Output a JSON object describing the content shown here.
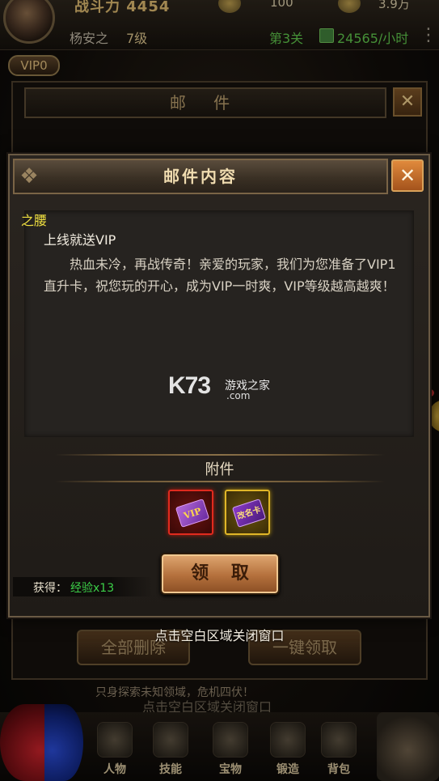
{
  "hud": {
    "power": "战斗力 4454",
    "resource1": "100",
    "resource2": "3.9万",
    "player_name": "杨安之",
    "player_level": "7级",
    "stage": "第3关",
    "income_rate": "24565/小时",
    "vip": "VIP0",
    "menu_icon": "menu-icon"
  },
  "mail_window": {
    "title": "邮 件",
    "delete_all": "全部删除",
    "claim_all": "一键领取",
    "scroll_text": "只身探索未知领域，危机四伏！",
    "close_hint": "点击空白区域关闭窗口"
  },
  "dialog": {
    "title": "邮件内容",
    "sender": "之腰",
    "subject": "上线就送VIP",
    "body": "热血未冷，再战传奇！亲爱的玩家，我们为您准备了VIP1直升卡，祝您玩的开心，成为VIP一时爽，VIP等级越高越爽！",
    "attachments_title": "附件",
    "attachments": [
      {
        "name": "VIP",
        "icon": "vip-card-icon"
      },
      {
        "name": "改名卡",
        "icon": "rename-card-icon"
      }
    ],
    "claim_button": "领 取",
    "reward_label": "获得：",
    "reward_value": "经验x13",
    "close_hint": "点击空白区域关闭窗口"
  },
  "watermark": {
    "logo": "K73",
    "name": "游戏之家",
    "domain": ".com"
  },
  "bottom_nav": [
    {
      "label": "人物",
      "icon": "helmet-icon"
    },
    {
      "label": "技能",
      "icon": "scroll-icon"
    },
    {
      "label": "宝物",
      "icon": "treasure-icon"
    },
    {
      "label": "锻造",
      "icon": "anvil-icon"
    },
    {
      "label": "背包",
      "icon": "bag-icon"
    }
  ],
  "colors": {
    "sender": "#f0e040",
    "reward": "#3ccf48",
    "income": "#5cc04a",
    "close_button": "#e08a3c"
  }
}
